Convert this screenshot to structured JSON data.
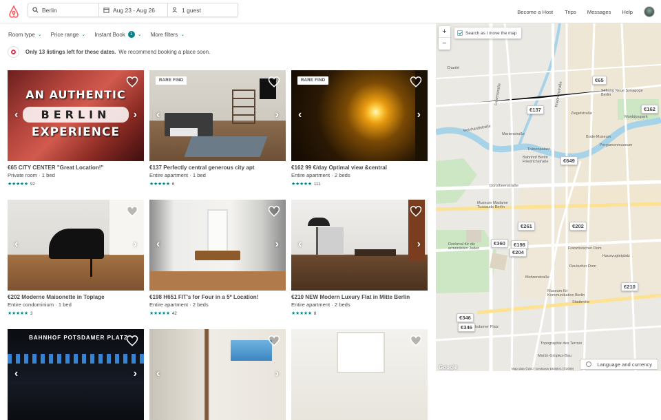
{
  "header": {
    "search": {
      "location": "Berlin",
      "dates": "Aug 23 - Aug 26",
      "guests": "1 guest"
    },
    "nav": [
      "Become a Host",
      "Trips",
      "Messages",
      "Help"
    ]
  },
  "filters": {
    "room_type": "Room type",
    "price_range": "Price range",
    "instant_book": "Instant Book",
    "instant_book_count": "1",
    "more_filters": "More filters"
  },
  "notice": {
    "bold": "Only 13 listings left for these dates.",
    "text": "We recommend booking a place soon."
  },
  "listings": [
    {
      "title": "€65 CITY CENTER \"Great Location!\"",
      "sub": "Private room · 1 bed",
      "stars": "★★★★★",
      "reviews": "92",
      "badge": "",
      "photo_text": [
        "AN AUTHENTIC",
        "BERLIN",
        "EXPERIENCE"
      ]
    },
    {
      "title": "€137 Perfectly central generous city apt",
      "sub": "Entire apartment · 1 bed",
      "stars": "★★★★★",
      "reviews": "6",
      "badge": "RARE FIND"
    },
    {
      "title": "€162 99 €/day Optimal view &central",
      "sub": "Entire apartment · 2 beds",
      "stars": "★★★★★",
      "reviews": "111",
      "badge": "RARE FIND"
    },
    {
      "title": "€202 Moderne Maisonette in Toplage",
      "sub": "Entire condominium · 1 bed",
      "stars": "★★★★★",
      "reviews": "3",
      "badge": ""
    },
    {
      "title": "€198 H651 FIT's for Four in a 5* Location!",
      "sub": "Entire apartment · 2 beds",
      "stars": "★★★★★",
      "reviews": "42",
      "badge": ""
    },
    {
      "title": "€210 NEW Modern Luxury Flat in Mitte Berlin",
      "sub": "Entire apartment · 2 beds",
      "stars": "★★★★★",
      "reviews": "8",
      "badge": ""
    },
    {
      "title": "",
      "sub": "",
      "stars": "",
      "reviews": "",
      "badge": "",
      "photo_text": [
        "BAHNHOF POTSDAMER PLATZ"
      ]
    },
    {
      "title": "",
      "sub": "",
      "stars": "",
      "reviews": "",
      "badge": ""
    },
    {
      "title": "",
      "sub": "",
      "stars": "",
      "reviews": "",
      "badge": ""
    }
  ],
  "map": {
    "move_map_label": "Search as I move the map",
    "zoom_in": "+",
    "zoom_out": "−",
    "price_pins": [
      "€65",
      "€137",
      "€162",
      "€649",
      "€261",
      "€202",
      "€360",
      "€198",
      "€204",
      "€210",
      "€346",
      "€346"
    ],
    "labels": [
      "Charité",
      "Stiftung Neue Synagoge Berlin",
      "Ziegelstraße",
      "Monbijoupark",
      "Bode-Museum",
      "Pergamonmuseum",
      "Tränenpalast",
      "Bahnhof Berlin Friedrichstraße",
      "Dorotheenstraße",
      "Museum Madame Tussauds Berlin",
      "Denkmal für die ermordeten Juden",
      "Französischer Dom",
      "Deutscher Dom",
      "Museum für Kommunikation Berlin",
      "Potsdamer Platz",
      "Topographie des Terrors",
      "Martin-Gropius-Bau",
      "Reinhardtstraße",
      "Marienstraße",
      "Luisenstraße",
      "Friedrichstraße",
      "Mohrenstraße",
      "Stadtmitte",
      "Hausvogteiplatz"
    ],
    "language_button": "Language and currency",
    "credit": "Map data ©2017 GeoBasis-DE/BKG (©2009)",
    "google": "Google"
  },
  "colors": {
    "brand": "#FF5A5F",
    "accent": "#008489",
    "text": "#484848"
  }
}
